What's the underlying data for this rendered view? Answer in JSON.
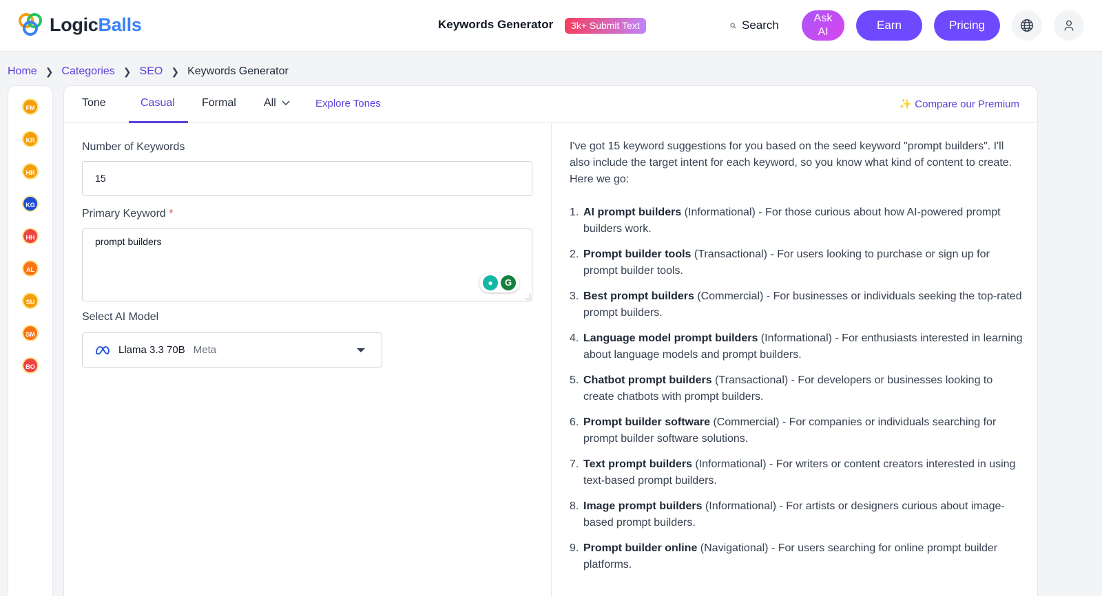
{
  "header": {
    "logo_word1": "Logic",
    "logo_word2": "Balls",
    "title": "Keywords Generator",
    "badge": "3k+ Submit Text",
    "search_label": "Search",
    "ask_ai_line1": "Ask",
    "ask_ai_line2": "AI",
    "earn_label": "Earn",
    "pricing_label": "Pricing"
  },
  "breadcrumb": [
    "Home",
    "Categories",
    "SEO",
    "Keywords Generator"
  ],
  "sidebar": {
    "items": [
      {
        "initials": "FM",
        "color": "#f59e0b"
      },
      {
        "initials": "KR",
        "color": "#f59e0b"
      },
      {
        "initials": "HR",
        "color": "#f59e0b"
      },
      {
        "initials": "KG",
        "color": "#1d4ed8"
      },
      {
        "initials": "HH",
        "color": "#ef4444"
      },
      {
        "initials": "AL",
        "color": "#f97316"
      },
      {
        "initials": "SU",
        "color": "#f59e0b"
      },
      {
        "initials": "SM",
        "color": "#f97316"
      },
      {
        "initials": "BO",
        "color": "#ef4444"
      }
    ]
  },
  "tabs": {
    "tone": "Tone",
    "casual": "Casual",
    "formal": "Formal",
    "all": "All",
    "explore": "Explore Tones",
    "premium": "Compare our Premium"
  },
  "form": {
    "num_keywords_label": "Number of Keywords",
    "num_keywords_value": "15",
    "primary_keyword_label": "Primary Keyword",
    "required_mark": "*",
    "primary_keyword_value": "prompt builders",
    "model_label": "Select AI Model",
    "model_name": "Llama 3.3 70B",
    "model_vendor": "Meta"
  },
  "output": {
    "intro": "I've got 15 keyword suggestions for you based on the seed keyword \"prompt builders\". I'll also include the target intent for each keyword, so you know what kind of content to create. Here we go:",
    "items": [
      {
        "num": "1.",
        "keyword": "AI prompt builders",
        "rest": " (Informational) - For those curious about how AI-powered prompt builders work."
      },
      {
        "num": "2.",
        "keyword": "Prompt builder tools",
        "rest": " (Transactional) - For users looking to purchase or sign up for prompt builder tools."
      },
      {
        "num": "3.",
        "keyword": "Best prompt builders",
        "rest": " (Commercial) - For businesses or individuals seeking the top-rated prompt builders."
      },
      {
        "num": "4.",
        "keyword": "Language model prompt builders",
        "rest": " (Informational) - For enthusiasts interested in learning about language models and prompt builders."
      },
      {
        "num": "5.",
        "keyword": "Chatbot prompt builders",
        "rest": " (Transactional) - For developers or businesses looking to create chatbots with prompt builders."
      },
      {
        "num": "6.",
        "keyword": "Prompt builder software",
        "rest": " (Commercial) - For companies or individuals searching for prompt builder software solutions."
      },
      {
        "num": "7.",
        "keyword": "Text prompt builders",
        "rest": " (Informational) - For writers or content creators interested in using text-based prompt builders."
      },
      {
        "num": "8.",
        "keyword": "Image prompt builders",
        "rest": " (Informational) - For artists or designers curious about image-based prompt builders."
      },
      {
        "num": "9.",
        "keyword": "Prompt builder online",
        "rest": " (Navigational) - For users searching for online prompt builder platforms."
      }
    ]
  }
}
